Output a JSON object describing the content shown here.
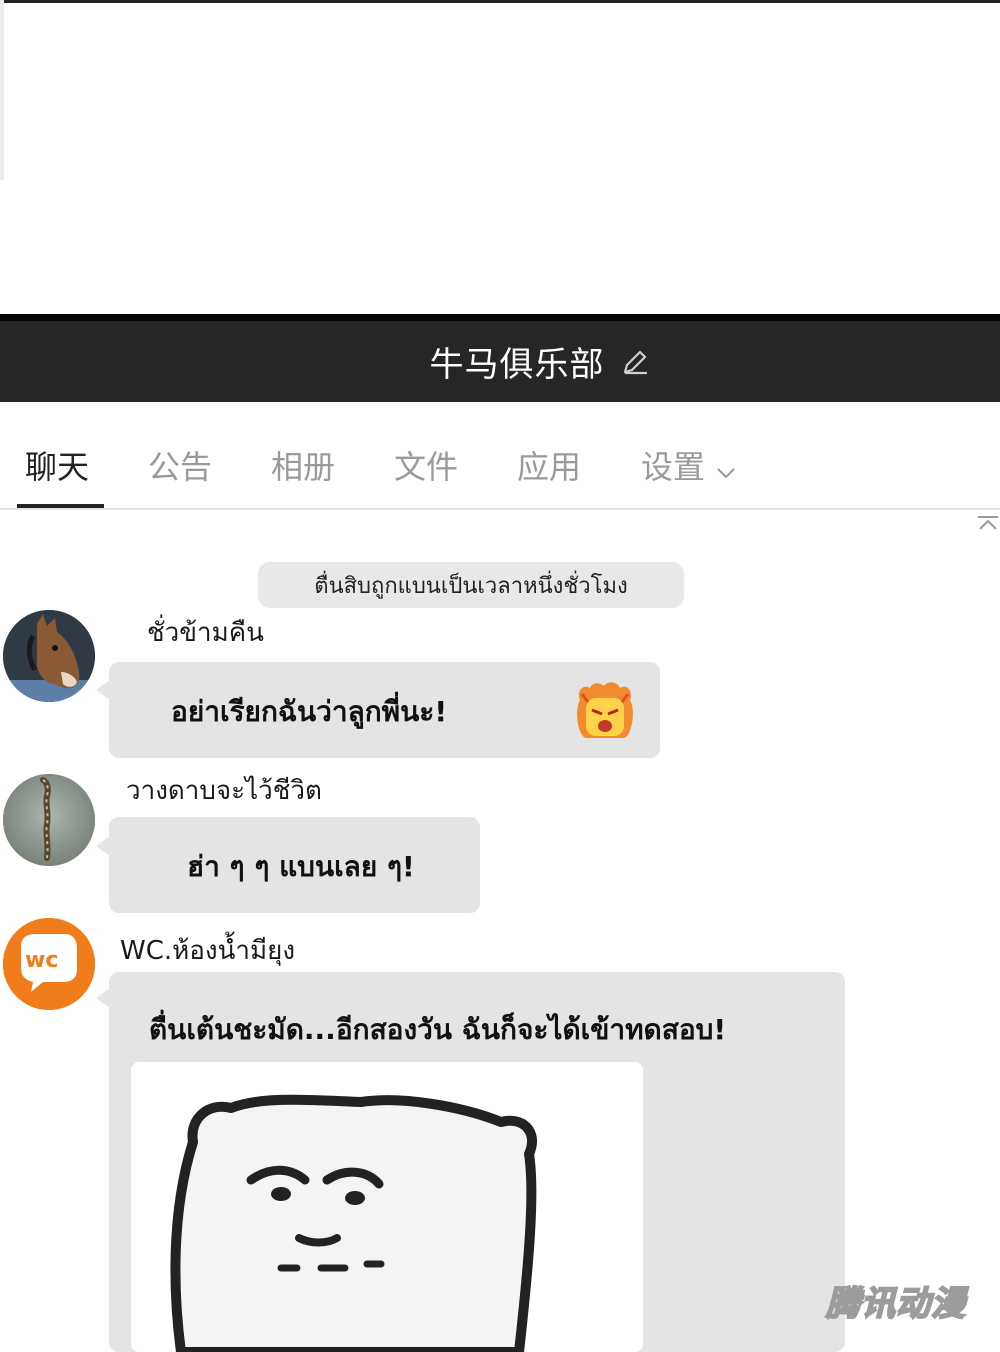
{
  "header": {
    "title": "牛马俱乐部",
    "edit_icon": "edit-pencil-icon"
  },
  "tabs": [
    {
      "label": "聊天",
      "active": true
    },
    {
      "label": "公告",
      "active": false
    },
    {
      "label": "相册",
      "active": false
    },
    {
      "label": "文件",
      "active": false
    },
    {
      "label": "应用",
      "active": false
    },
    {
      "label": "设置",
      "active": false
    }
  ],
  "settings_dropdown_icon": "chevron-down-icon",
  "collapse_icon": "collapse-up-icon",
  "system_notice": "ตื่นสิบถูกแบนเป็นเวลาหนึ่งชั่วโมง",
  "messages": [
    {
      "sender": "ชั่วข้ามคืน",
      "text": "อย่าเรียกฉันว่าลูกพี่นะ!",
      "avatar": "horse-avatar",
      "sticker": "angry-sticker-icon"
    },
    {
      "sender": "วางดาบจะไว้ชีวิต",
      "text": "ฮ่า ๆ ๆ แบนเลย ๆ!",
      "avatar": "sword-avatar"
    },
    {
      "sender": "WC.ห้องน้ำมียุง",
      "text": "ตื่นเต้นชะมัด...อีกสองวัน ฉันก็จะได้เข้าทดสอบ!",
      "avatar": "wc-avatar",
      "avatar_text": "wc",
      "image": "bear-meme-sticker"
    }
  ],
  "watermark": "腾讯动漫",
  "colors": {
    "header_bg": "#262626",
    "bubble_bg": "#e4e4e4",
    "wc_orange": "#f07d1a",
    "tab_inactive": "#9a9a9a"
  }
}
